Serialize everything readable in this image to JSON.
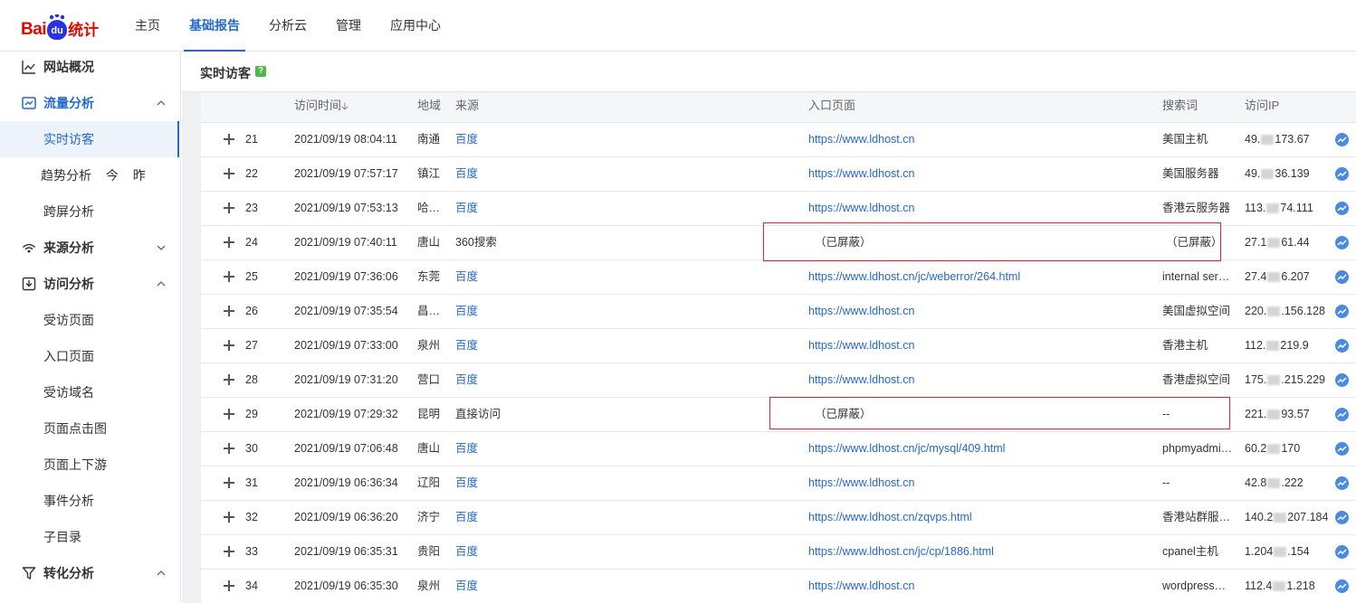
{
  "header": {
    "logo": {
      "bai": "Bai",
      "du": "du",
      "tongji": "统计"
    },
    "nav": [
      {
        "label": "主页",
        "active": false
      },
      {
        "label": "基础报告",
        "active": true
      },
      {
        "label": "分析云",
        "active": false
      },
      {
        "label": "管理",
        "active": false
      },
      {
        "label": "应用中心",
        "active": false
      }
    ]
  },
  "sidebar": {
    "overview": "网站概况",
    "traffic": {
      "label": "流量分析",
      "items": {
        "realtime": "实时访客",
        "trend": "趋势分析",
        "today": "今",
        "yesterday": "昨",
        "crossscreen": "跨屏分析"
      }
    },
    "source": {
      "label": "来源分析"
    },
    "visit": {
      "label": "访问分析",
      "items": [
        "受访页面",
        "入口页面",
        "受访域名",
        "页面点击图",
        "页面上下游",
        "事件分析",
        "子目录"
      ]
    },
    "conversion": {
      "label": "转化分析"
    }
  },
  "main": {
    "title": "实时访客",
    "help": "?",
    "columns": {
      "time": "访问时间",
      "sort_arrow": "🡣",
      "region": "地域",
      "source": "来源",
      "entry": "入口页面",
      "keyword": "搜索词",
      "ip": "访问IP"
    },
    "rows": [
      {
        "no": "21",
        "time": "2021/09/19 08:04:11",
        "region": "南通",
        "source": "百度",
        "source_link": true,
        "entry": "https://www.ldhost.cn",
        "entry_link": true,
        "keyword": "美国主机",
        "ip_a": "49.",
        "ip_b": "173.67"
      },
      {
        "no": "22",
        "time": "2021/09/19 07:57:17",
        "region": "镇江",
        "source": "百度",
        "source_link": true,
        "entry": "https://www.ldhost.cn",
        "entry_link": true,
        "keyword": "美国服务器",
        "ip_a": "49.",
        "ip_b": "36.139"
      },
      {
        "no": "23",
        "time": "2021/09/19 07:53:13",
        "region": "哈…",
        "source": "百度",
        "source_link": true,
        "entry": "https://www.ldhost.cn",
        "entry_link": true,
        "keyword": "香港云服务器",
        "ip_a": "113.",
        "ip_b": "74.111"
      },
      {
        "no": "24",
        "time": "2021/09/19 07:40:11",
        "region": "唐山",
        "source": "360搜索",
        "source_link": false,
        "entry": "（已屏蔽）",
        "entry_link": false,
        "keyword": "（已屏蔽）",
        "ip_a": "27.1",
        "ip_b": "61.44"
      },
      {
        "no": "25",
        "time": "2021/09/19 07:36:06",
        "region": "东莞",
        "source": "百度",
        "source_link": true,
        "entry": "https://www.ldhost.cn/jc/weberror/264.html",
        "entry_link": true,
        "keyword": "internal ser…",
        "ip_a": "27.4",
        "ip_b": "6.207"
      },
      {
        "no": "26",
        "time": "2021/09/19 07:35:54",
        "region": "昌…",
        "source": "百度",
        "source_link": true,
        "entry": "https://www.ldhost.cn",
        "entry_link": true,
        "keyword": "美国虚拟空间",
        "ip_a": "220.",
        "ip_b": ".156.128"
      },
      {
        "no": "27",
        "time": "2021/09/19 07:33:00",
        "region": "泉州",
        "source": "百度",
        "source_link": true,
        "entry": "https://www.ldhost.cn",
        "entry_link": true,
        "keyword": "香港主机",
        "ip_a": "112.",
        "ip_b": "219.9"
      },
      {
        "no": "28",
        "time": "2021/09/19 07:31:20",
        "region": "营口",
        "source": "百度",
        "source_link": true,
        "entry": "https://www.ldhost.cn",
        "entry_link": true,
        "keyword": "香港虚拟空间",
        "ip_a": "175.",
        "ip_b": ".215.229"
      },
      {
        "no": "29",
        "time": "2021/09/19 07:29:32",
        "region": "昆明",
        "source": "直接访问",
        "source_link": false,
        "entry": "（已屏蔽）",
        "entry_link": false,
        "keyword": "--",
        "ip_a": "221.",
        "ip_b": "93.57"
      },
      {
        "no": "30",
        "time": "2021/09/19 07:06:48",
        "region": "唐山",
        "source": "百度",
        "source_link": true,
        "entry": "https://www.ldhost.cn/jc/mysql/409.html",
        "entry_link": true,
        "keyword": "phpmyadmi…",
        "ip_a": "60.2",
        "ip_b": "170"
      },
      {
        "no": "31",
        "time": "2021/09/19 06:36:34",
        "region": "辽阳",
        "source": "百度",
        "source_link": true,
        "entry": "https://www.ldhost.cn",
        "entry_link": true,
        "keyword": "--",
        "ip_a": "42.8",
        "ip_b": ".222"
      },
      {
        "no": "32",
        "time": "2021/09/19 06:36:20",
        "region": "济宁",
        "source": "百度",
        "source_link": true,
        "entry": "https://www.ldhost.cn/zqvps.html",
        "entry_link": true,
        "keyword": "香港站群服…",
        "ip_a": "140.2",
        "ip_b": "207.184"
      },
      {
        "no": "33",
        "time": "2021/09/19 06:35:31",
        "region": "贵阳",
        "source": "百度",
        "source_link": true,
        "entry": "https://www.ldhost.cn/jc/cp/1886.html",
        "entry_link": true,
        "keyword": "cpanel主机",
        "ip_a": "1.204",
        "ip_b": ".154"
      },
      {
        "no": "34",
        "time": "2021/09/19 06:35:30",
        "region": "泉州",
        "source": "百度",
        "source_link": true,
        "entry": "https://www.ldhost.cn",
        "entry_link": true,
        "keyword": "wordpress…",
        "ip_a": "112.4",
        "ip_b": "1.218"
      }
    ]
  }
}
